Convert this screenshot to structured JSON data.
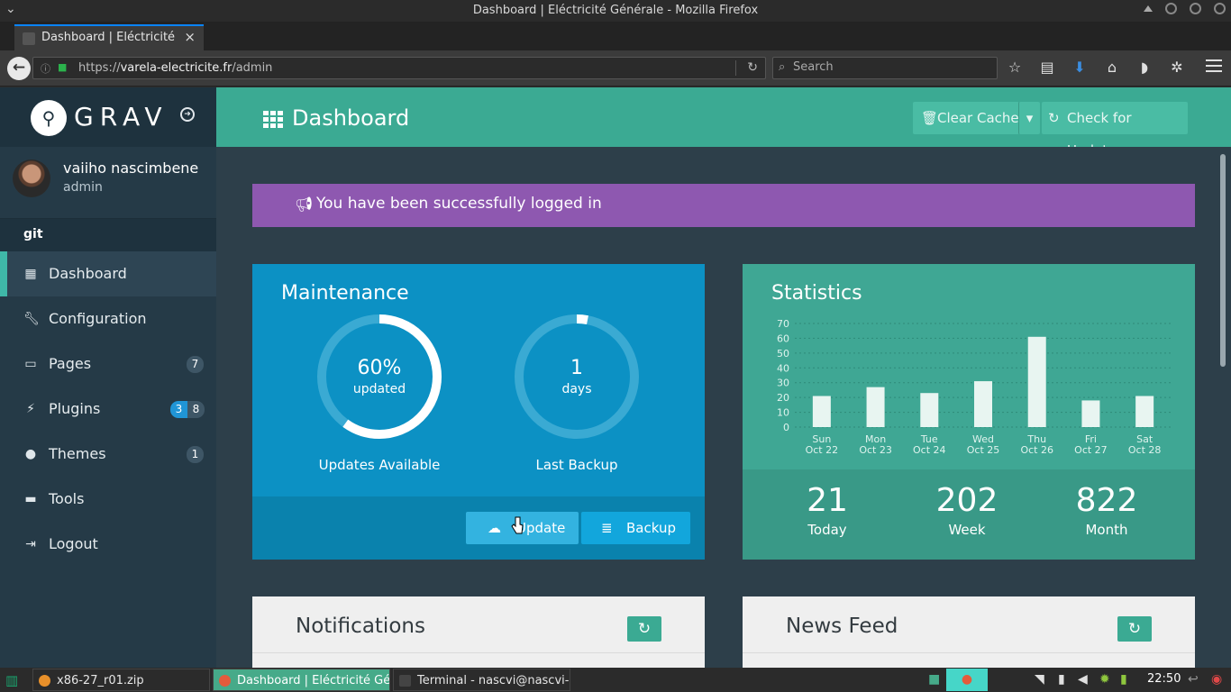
{
  "window": {
    "title": "Dashboard | Eléctricité Générale - Mozilla Firefox"
  },
  "browser": {
    "tab_title": "Dashboard | Eléctricité Gé",
    "url_scheme": "https://",
    "url_host": "varela-electricite.fr",
    "url_path": "/admin",
    "search_placeholder": "Search"
  },
  "sidebar": {
    "brand": "GRAV",
    "user_name": "vaiiho nascimbene",
    "user_role": "admin",
    "section": "git",
    "items": [
      {
        "label": "Dashboard",
        "icon": "grid-icon"
      },
      {
        "label": "Configuration",
        "icon": "wrench-icon"
      },
      {
        "label": "Pages",
        "icon": "file-icon",
        "badge": "7"
      },
      {
        "label": "Plugins",
        "icon": "plug-icon",
        "badge_updates": "3",
        "badge": "8"
      },
      {
        "label": "Themes",
        "icon": "drop-icon",
        "badge": "1"
      },
      {
        "label": "Tools",
        "icon": "briefcase-icon"
      },
      {
        "label": "Logout",
        "icon": "logout-icon"
      }
    ]
  },
  "header": {
    "title": "Dashboard",
    "clear_cache": "Clear Cache",
    "check_updates": "Check for Updates"
  },
  "alert": {
    "message": "You have been successfully logged in"
  },
  "maintenance": {
    "title": "Maintenance",
    "updates_value": "60%",
    "updates_unit": "updated",
    "updates_percent": 60,
    "updates_caption": "Updates Available",
    "backup_value": "1",
    "backup_unit": "days",
    "backup_fraction": 0.03,
    "backup_caption": "Last Backup",
    "update_button": "Update",
    "backup_button": "Backup"
  },
  "statistics": {
    "title": "Statistics",
    "today_value": "21",
    "today_label": "Today",
    "week_value": "202",
    "week_label": "Week",
    "month_value": "822",
    "month_label": "Month"
  },
  "chart_data": {
    "type": "bar",
    "categories": [
      "Sun Oct 22",
      "Mon Oct 23",
      "Tue Oct 24",
      "Wed Oct 25",
      "Thu Oct 26",
      "Fri Oct 27",
      "Sat Oct 28"
    ],
    "day_labels": [
      "Sun",
      "Mon",
      "Tue",
      "Wed",
      "Thu",
      "Fri",
      "Sat"
    ],
    "date_labels": [
      "Oct 22",
      "Oct 23",
      "Oct 24",
      "Oct 25",
      "Oct 26",
      "Oct 27",
      "Oct 28"
    ],
    "values": [
      21,
      27,
      23,
      31,
      61,
      18,
      21
    ],
    "yticks": [
      "0",
      "10",
      "20",
      "30",
      "40",
      "50",
      "60",
      "70"
    ],
    "ylim": [
      0,
      70
    ],
    "grid": true,
    "title": "",
    "xlabel": "",
    "ylabel": ""
  },
  "panels": {
    "notifications": "Notifications",
    "news_feed": "News Feed"
  },
  "taskbar": {
    "items": [
      "x86-27_r01.zip",
      "Dashboard | Eléctricité Gé...",
      "Terminal - nascvi@nascvi-p..."
    ],
    "clock": "22:50"
  },
  "colors": {
    "accent": "#3baa93",
    "maintenance": "#0c91c4",
    "alert": "#8e58b0",
    "sidebar": "#253a47"
  }
}
